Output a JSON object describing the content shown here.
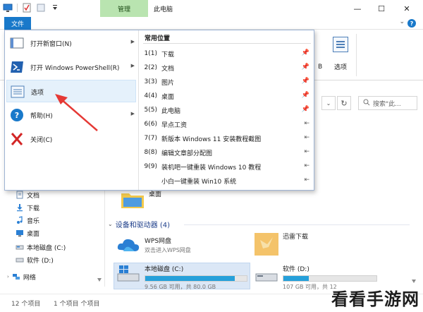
{
  "titlebar": {
    "context_tab": "管理",
    "title": "此电脑",
    "win_minimize": "—",
    "win_maximize": "☐",
    "win_close": "✕"
  },
  "tabstrip": {
    "file_tab": "文件",
    "help": "?",
    "collapse": "⌄"
  },
  "ribbon": {
    "options_label": "选项",
    "frag_b": "B"
  },
  "addressbar": {
    "search_placeholder": "搜索\"此..."
  },
  "navpane": {
    "items": [
      {
        "label": "文档",
        "icon": "documents-icon"
      },
      {
        "label": "下载",
        "icon": "download-icon"
      },
      {
        "label": "音乐",
        "icon": "music-icon"
      },
      {
        "label": "桌面",
        "icon": "desktop-icon"
      },
      {
        "label": "本地磁盘 (C:)",
        "icon": "drive-icon"
      },
      {
        "label": "软件 (D:)",
        "icon": "drive-icon"
      },
      {
        "label": "网络",
        "icon": "network-icon"
      }
    ]
  },
  "content": {
    "folder_label": "桌面",
    "section_title": "设备和驱动器 (4)",
    "wps": {
      "name": "WPS网盘",
      "sub": "双击进入WPS网盘"
    },
    "thunder": {
      "name": "迅雷下载"
    },
    "drive_c": {
      "name": "本地磁盘 (C:)",
      "free": "9.56 GB 可用，共 80.0 GB",
      "used_fraction": 0.88
    },
    "drive_d": {
      "name": "软件 (D:)",
      "free": "107 GB 可用，共 12",
      "used_fraction": 0.27
    }
  },
  "statusbar": {
    "count": "12 个项目",
    "selected": "1 个项目 个项目"
  },
  "filemenu": {
    "items": [
      {
        "label": "打开新窗口(N)",
        "arrow": "▶"
      },
      {
        "label": "打开 Windows PowerShell(R)",
        "arrow": "▶"
      },
      {
        "label": "选项",
        "arrow": ""
      },
      {
        "label": "帮助(H)",
        "arrow": "▶"
      },
      {
        "label": "关闭(C)",
        "arrow": ""
      }
    ],
    "recent_header": "常用位置",
    "recent": [
      {
        "num": "1(1)",
        "label": "下载",
        "pin": "pinned"
      },
      {
        "num": "2(2)",
        "label": "文档",
        "pin": "pinned"
      },
      {
        "num": "3(3)",
        "label": "图片",
        "pin": "pinned"
      },
      {
        "num": "4(4)",
        "label": "桌面",
        "pin": "pinned"
      },
      {
        "num": "5(5)",
        "label": "此电脑",
        "pin": "pinned"
      },
      {
        "num": "6(6)",
        "label": "早点工资",
        "pin": "unpinned"
      },
      {
        "num": "7(7)",
        "label": "新版本 Windows 11 安装教程截图",
        "pin": "unpinned"
      },
      {
        "num": "8(8)",
        "label": "编辑文章部分配图",
        "pin": "unpinned"
      },
      {
        "num": "9(9)",
        "label": "装机吧一键重装 Windows 10 教程",
        "pin": "unpinned"
      },
      {
        "num": "",
        "label": "小白一键重装 Win10 系统",
        "pin": "unpinned"
      }
    ],
    "pin_glyphs": {
      "pinned": "📌",
      "unpinned": "⇤"
    }
  },
  "watermark": "看看手游网",
  "colors": {
    "accent": "#1979ca",
    "context_tab": "#b9e4b0",
    "drive_fill": "#26a0da",
    "annotation_arrow": "#e53935"
  }
}
